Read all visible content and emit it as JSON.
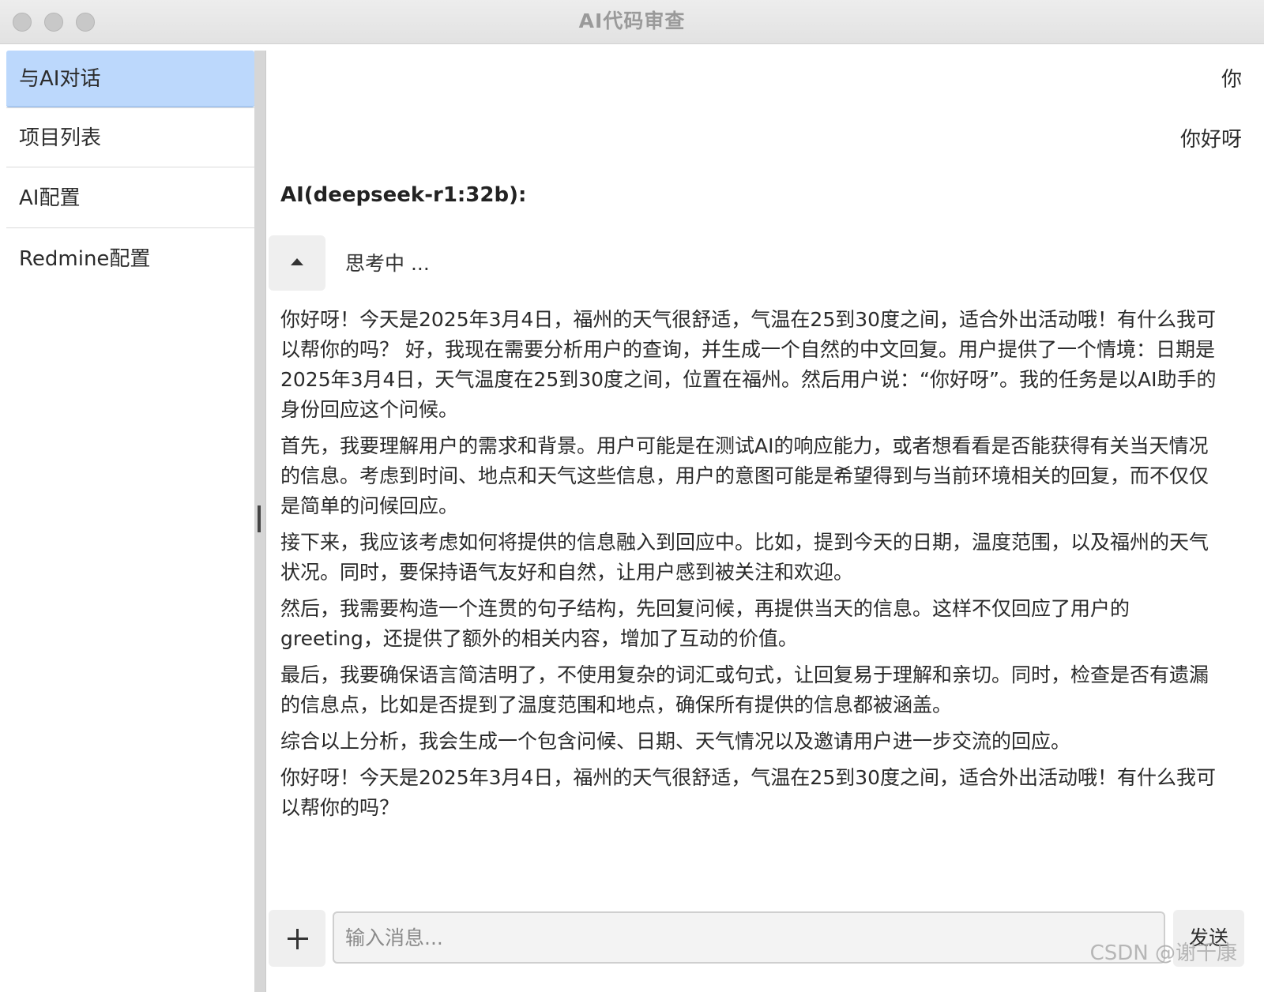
{
  "window": {
    "title": "AI代码审查"
  },
  "sidebar": {
    "items": [
      {
        "label": "与AI对话"
      },
      {
        "label": "项目列表"
      },
      {
        "label": "AI配置"
      },
      {
        "label": "Redmine配置"
      }
    ]
  },
  "chat": {
    "user_messages": [
      "你",
      "你好呀"
    ],
    "ai_header": "AI(deepseek-r1:32b):",
    "thinking_label": "思考中 ...",
    "ai_paragraphs": [
      "你好呀！今天是2025年3月4日，福州的天气很舒适，气温在25到30度之间，适合外出活动哦！有什么我可以帮你的吗？ 好，我现在需要分析用户的查询，并生成一个自然的中文回复。用户提供了一个情境：日期是2025年3月4日，天气温度在25到30度之间，位置在福州。然后用户说：“你好呀”。我的任务是以AI助手的身份回应这个问候。",
      "首先，我要理解用户的需求和背景。用户可能是在测试AI的响应能力，或者想看看是否能获得有关当天情况的信息。考虑到时间、地点和天气这些信息，用户的意图可能是希望得到与当前环境相关的回复，而不仅仅是简单的问候回应。",
      "接下来，我应该考虑如何将提供的信息融入到回应中。比如，提到今天的日期，温度范围，以及福州的天气状况。同时，要保持语气友好和自然，让用户感到被关注和欢迎。",
      "然后，我需要构造一个连贯的句子结构，先回复问候，再提供当天的信息。这样不仅回应了用户的greeting，还提供了额外的相关内容，增加了互动的价值。",
      "最后，我要确保语言简洁明了，不使用复杂的词汇或句式，让回复易于理解和亲切。同时，检查是否有遗漏的信息点，比如是否提到了温度范围和地点，确保所有提供的信息都被涵盖。",
      "综合以上分析，我会生成一个包含问候、日期、天气情况以及邀请用户进一步交流的回应。",
      "你好呀！今天是2025年3月4日，福州的天气很舒适，气温在25到30度之间，适合外出活动哦！有什么我可以帮你的吗？"
    ]
  },
  "input": {
    "placeholder": "输入消息...",
    "add_icon": "plus-icon",
    "send_label": "发送"
  },
  "watermark": "CSDN @谢千康"
}
